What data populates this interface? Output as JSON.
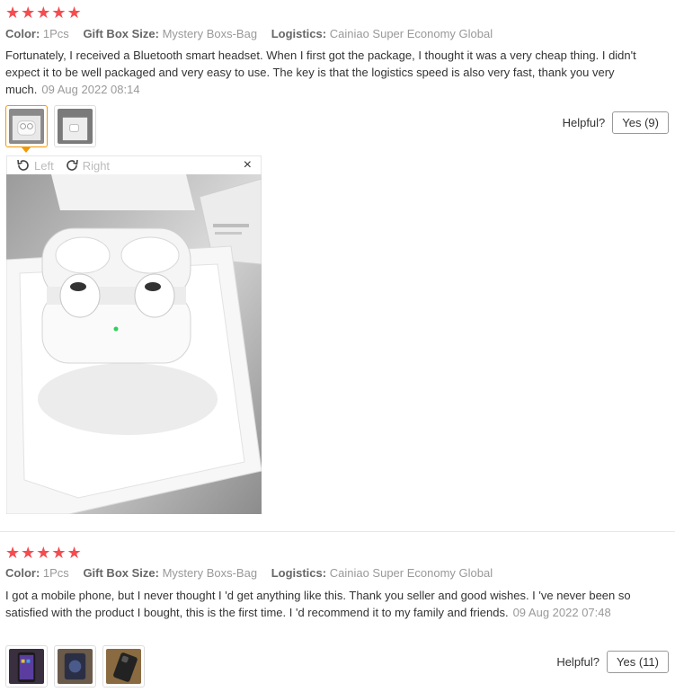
{
  "reviews": [
    {
      "stars": "★★★★★",
      "color_label": "Color:",
      "color_value": "1Pcs",
      "gift_label": "Gift Box Size:",
      "gift_value": "Mystery Boxs-Bag",
      "logistics_label": "Logistics:",
      "logistics_value": "Cainiao Super Economy Global",
      "text": "Fortunately, I received a Bluetooth smart headset. When I first got the package, I thought it was a very cheap thing. I didn't expect it to be well packaged and very easy to use. The key is that the logistics speed is also very fast, thank you very much.",
      "date": "09 Aug 2022 08:14",
      "helpful_label": "Helpful?",
      "yes_label": "Yes (9)"
    },
    {
      "stars": "★★★★★",
      "color_label": "Color:",
      "color_value": "1Pcs",
      "gift_label": "Gift Box Size:",
      "gift_value": "Mystery Boxs-Bag",
      "logistics_label": "Logistics:",
      "logistics_value": "Cainiao Super Economy Global",
      "text": "I got a mobile phone, but I never thought I 'd get anything like this. Thank you seller and good wishes. I 've never been so satisfied with the product I bought, this is the first time. I 'd recommend it to my family and friends.",
      "date": "09 Aug 2022 07:48",
      "helpful_label": "Helpful?",
      "yes_label": "Yes (11)"
    }
  ],
  "viewer": {
    "rotate_left": "Left",
    "rotate_right": "Right",
    "close": "×"
  },
  "colors": {
    "star": "#f44d50",
    "active_thumb": "#f39800"
  }
}
